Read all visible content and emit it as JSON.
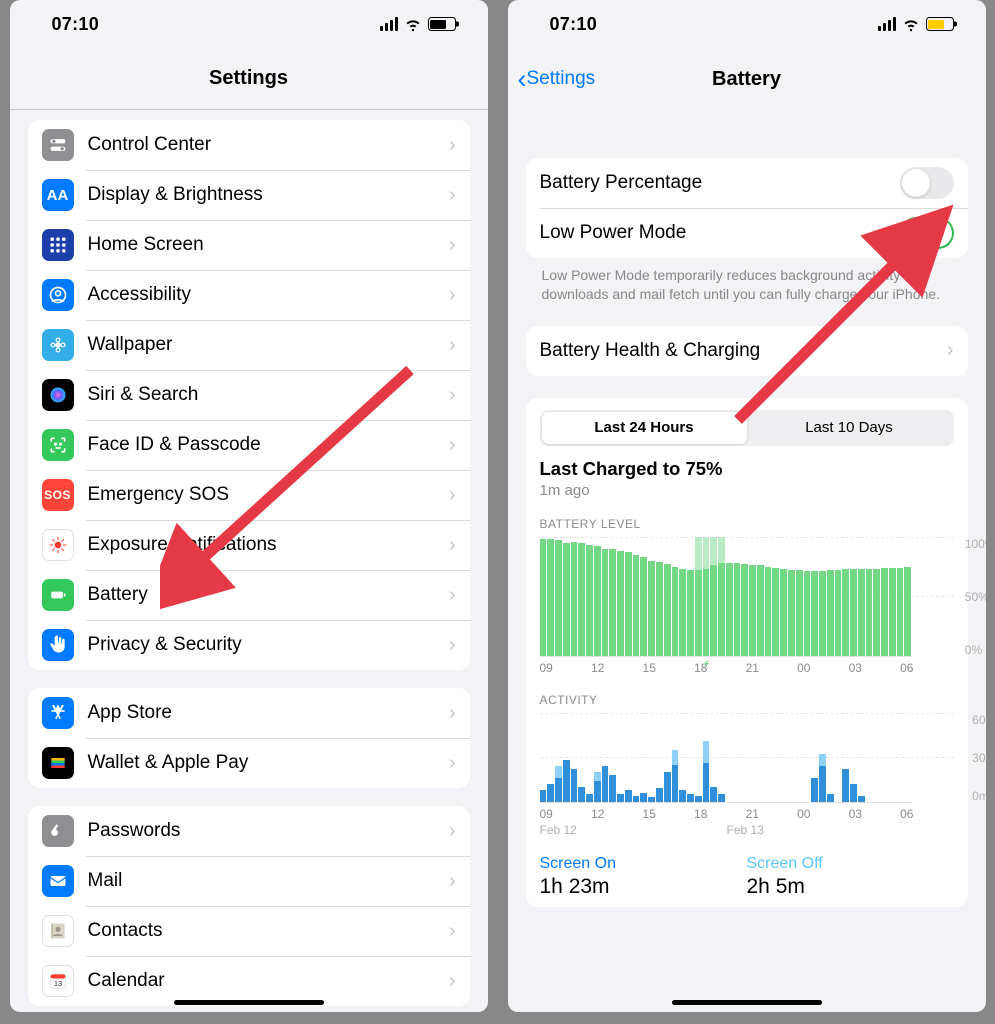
{
  "status": {
    "time": "07:10"
  },
  "left": {
    "title": "Settings",
    "groups": [
      {
        "items": [
          {
            "id": "control-center",
            "label": "Control Center",
            "icon": "toggles",
            "bg": "bg-grey"
          },
          {
            "id": "display",
            "label": "Display & Brightness",
            "icon": "aa",
            "bg": "bg-blue"
          },
          {
            "id": "home-screen",
            "label": "Home Screen",
            "icon": "grid",
            "bg": "bg-navy"
          },
          {
            "id": "accessibility",
            "label": "Accessibility",
            "icon": "person-circle",
            "bg": "bg-blue"
          },
          {
            "id": "wallpaper",
            "label": "Wallpaper",
            "icon": "flower",
            "bg": "bg-cyan"
          },
          {
            "id": "siri",
            "label": "Siri & Search",
            "icon": "siri",
            "bg": "bg-black"
          },
          {
            "id": "faceid",
            "label": "Face ID & Passcode",
            "icon": "face",
            "bg": "bg-green"
          },
          {
            "id": "sos",
            "label": "Emergency SOS",
            "icon": "sos",
            "bg": "bg-red2"
          },
          {
            "id": "exposure",
            "label": "Exposure Notifications",
            "icon": "exposure",
            "bg": "bg-white"
          },
          {
            "id": "battery",
            "label": "Battery",
            "icon": "battery",
            "bg": "bg-green"
          },
          {
            "id": "privacy",
            "label": "Privacy & Security",
            "icon": "hand",
            "bg": "bg-blue"
          }
        ]
      },
      {
        "items": [
          {
            "id": "appstore",
            "label": "App Store",
            "icon": "appstore",
            "bg": "bg-blue"
          },
          {
            "id": "wallet",
            "label": "Wallet & Apple Pay",
            "icon": "wallet",
            "bg": "bg-black"
          }
        ]
      },
      {
        "items": [
          {
            "id": "passwords",
            "label": "Passwords",
            "icon": "key",
            "bg": "bg-grey"
          },
          {
            "id": "mail",
            "label": "Mail",
            "icon": "mail",
            "bg": "bg-blue"
          },
          {
            "id": "contacts",
            "label": "Contacts",
            "icon": "contacts",
            "bg": "bg-white"
          },
          {
            "id": "calendar",
            "label": "Calendar",
            "icon": "calendar",
            "bg": "bg-white"
          }
        ]
      }
    ]
  },
  "right": {
    "back": "Settings",
    "title": "Battery",
    "toggles": {
      "percentage": {
        "label": "Battery Percentage",
        "on": false
      },
      "lowpower": {
        "label": "Low Power Mode",
        "on": true
      }
    },
    "lowpower_footer": "Low Power Mode temporarily reduces background activity like downloads and mail fetch until you can fully charge your iPhone.",
    "health_row": "Battery Health & Charging",
    "segmented": {
      "a": "Last 24 Hours",
      "b": "Last 10 Days",
      "active": "a"
    },
    "last_charged": {
      "title": "Last Charged to 75%",
      "sub": "1m ago"
    },
    "battery_chart_label": "BATTERY LEVEL",
    "activity_chart_label": "ACTIVITY",
    "stats": {
      "screen_on": {
        "label": "Screen On",
        "value": "1h 23m"
      },
      "screen_off": {
        "label": "Screen Off",
        "value": "2h 5m"
      }
    }
  },
  "chart_data": [
    {
      "type": "bar",
      "title": "BATTERY LEVEL",
      "ylabel": "%",
      "ylim": [
        0,
        100
      ],
      "yticks": [
        0,
        50,
        100
      ],
      "xticks": [
        "09",
        "12",
        "15",
        "18",
        "21",
        "00",
        "03",
        "06"
      ],
      "date_labels": [
        "Feb 12",
        "Feb 13"
      ],
      "values": [
        98,
        98,
        97,
        95,
        96,
        95,
        93,
        92,
        90,
        90,
        88,
        87,
        85,
        83,
        80,
        79,
        77,
        75,
        73,
        72,
        72,
        73,
        76,
        78,
        78,
        78,
        77,
        76,
        76,
        75,
        74,
        73,
        72,
        72,
        71,
        71,
        71,
        72,
        72,
        73,
        73,
        73,
        73,
        73,
        74,
        74,
        74,
        75
      ],
      "light_overlay_values": [
        0,
        0,
        0,
        0,
        0,
        0,
        0,
        0,
        0,
        0,
        0,
        0,
        0,
        0,
        0,
        0,
        0,
        0,
        0,
        0,
        100,
        100,
        100,
        100,
        0,
        0,
        0,
        0,
        0,
        0,
        0,
        0,
        0,
        0,
        0,
        0,
        0,
        0,
        0,
        0,
        0,
        0,
        0,
        0,
        0,
        0,
        0,
        0
      ]
    },
    {
      "type": "bar",
      "title": "ACTIVITY",
      "ylabel": "minutes",
      "ylim": [
        0,
        60
      ],
      "yticks": [
        0,
        30,
        60
      ],
      "xticks": [
        "09",
        "12",
        "15",
        "18",
        "21",
        "00",
        "03",
        "06"
      ],
      "date_labels": [
        "Feb 12",
        "Feb 13"
      ],
      "series": [
        {
          "name": "Screen On",
          "values": [
            8,
            12,
            16,
            28,
            22,
            10,
            5,
            14,
            24,
            18,
            5,
            8,
            4,
            6,
            3,
            9,
            20,
            25,
            8,
            5,
            4,
            26,
            10,
            5,
            0,
            0,
            0,
            0,
            0,
            0,
            0,
            0,
            0,
            0,
            0,
            16,
            24,
            5,
            0,
            22,
            12,
            4,
            0,
            0,
            0,
            0,
            0,
            0
          ]
        },
        {
          "name": "Screen Off",
          "values": [
            0,
            0,
            8,
            0,
            0,
            0,
            0,
            6,
            0,
            0,
            0,
            0,
            0,
            0,
            0,
            0,
            0,
            10,
            0,
            0,
            0,
            15,
            0,
            0,
            0,
            0,
            0,
            0,
            0,
            0,
            0,
            0,
            0,
            0,
            0,
            0,
            8,
            0,
            0,
            0,
            0,
            0,
            0,
            0,
            0,
            0,
            0,
            0
          ]
        }
      ]
    }
  ]
}
